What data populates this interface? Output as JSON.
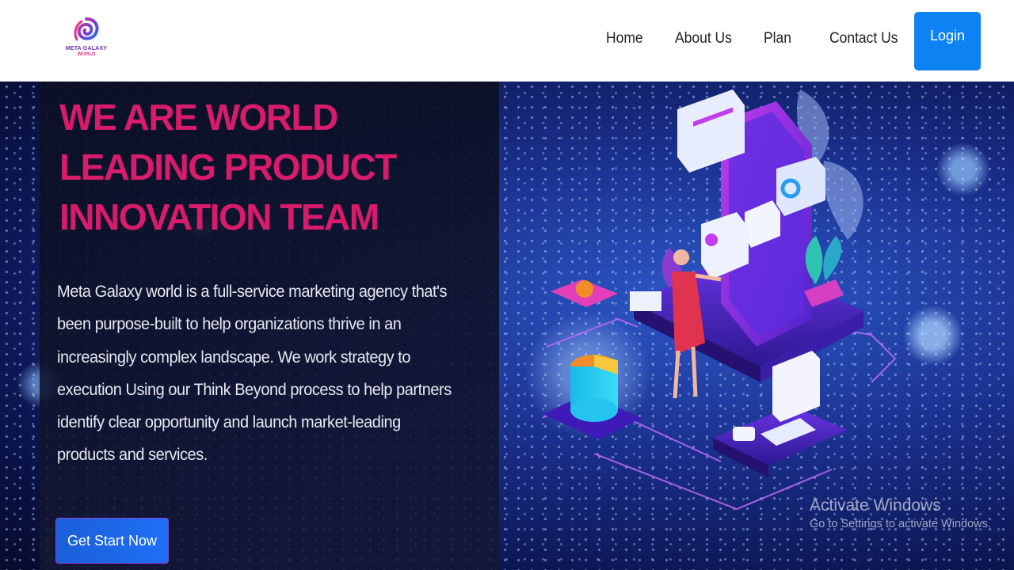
{
  "brand": {
    "name_line1": "META GALAXY",
    "name_line2": "WORLD"
  },
  "nav": {
    "items": [
      {
        "label": "Home"
      },
      {
        "label": "About Us"
      },
      {
        "label": "Plan"
      },
      {
        "label": "Contact Us"
      }
    ],
    "login_label": "Login"
  },
  "hero": {
    "headline_lines": [
      "WE ARE WORLD",
      "LEADING PRODUCT",
      "INNOVATION TEAM"
    ],
    "description": "Meta Galaxy world is a full-service marketing agency that's been purpose-built to help organizations thrive in an increasingly complex landscape. We work strategy to execution Using our Think Beyond process to help partners identify clear opportunity and launch market-leading products and services.",
    "cta_label": "Get Start Now"
  },
  "watermark": {
    "title": "Activate Windows",
    "subtitle": "Go to Settings to activate Windows."
  },
  "colors": {
    "headline": "#d81b6a",
    "login_button": "#0d82f2",
    "cta_button": "#1e6ff5",
    "cta_border": "#8f3bd6",
    "navbar_bg": "#ffffff"
  },
  "icons": [
    "galaxy-logo-icon",
    "isometric-phone-illustration"
  ]
}
